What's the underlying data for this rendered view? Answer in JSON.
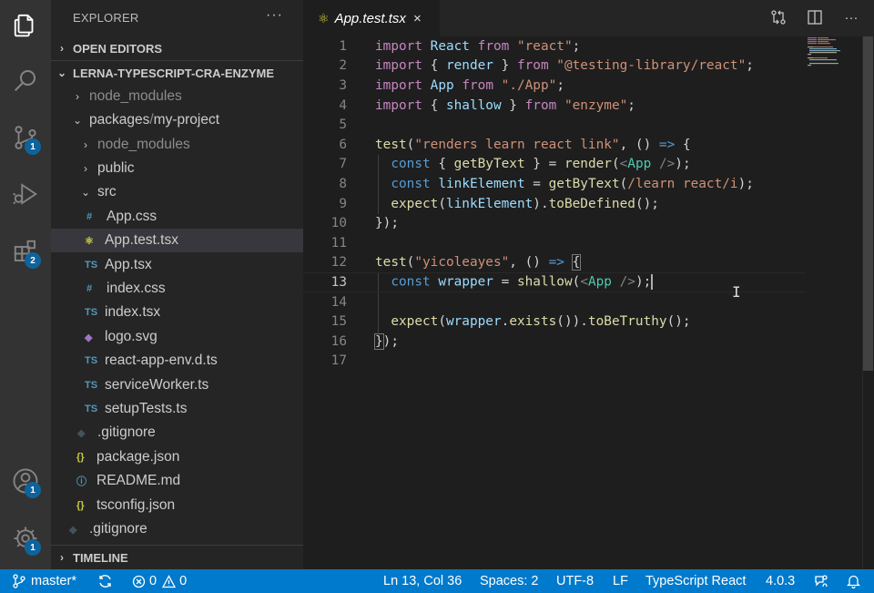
{
  "activity_bar": {
    "items": [
      {
        "name": "explorer",
        "icon": "files-icon",
        "badge": ""
      },
      {
        "name": "search",
        "icon": "search-icon",
        "badge": ""
      },
      {
        "name": "source-control",
        "icon": "source-control-icon",
        "badge": "1"
      },
      {
        "name": "run",
        "icon": "run-debug-icon",
        "badge": ""
      },
      {
        "name": "extensions",
        "icon": "extensions-icon",
        "badge": "2"
      }
    ],
    "accounts_badge": "1",
    "settings_badge": "1"
  },
  "sidebar": {
    "title": "EXPLORER",
    "more": "···",
    "open_editors": "OPEN EDITORS",
    "project": "LERNA-TYPESCRIPT-CRA-ENZYME",
    "timeline": "TIMELINE",
    "tree": [
      {
        "label": "node_modules",
        "icon": "",
        "chev": "›",
        "dim": true
      },
      {
        "label_a": "packages",
        "sep": " / ",
        "label_b": "my-project",
        "chev": "⌄"
      },
      {
        "label": "node_modules",
        "chev": "›",
        "dim": true
      },
      {
        "label": "public",
        "chev": "›"
      },
      {
        "label": "src",
        "chev": "⌄"
      },
      {
        "label": "App.css",
        "icon": "#"
      },
      {
        "label": "App.test.tsx",
        "icon": "⚛"
      },
      {
        "label": "App.tsx",
        "icon": "TS"
      },
      {
        "label": "index.css",
        "icon": "#"
      },
      {
        "label": "index.tsx",
        "icon": "TS"
      },
      {
        "label": "logo.svg",
        "icon": "◆"
      },
      {
        "label": "react-app-env.d.ts",
        "icon": "TS"
      },
      {
        "label": "serviceWorker.ts",
        "icon": "TS"
      },
      {
        "label": "setupTests.ts",
        "icon": "TS"
      },
      {
        "label": ".gitignore",
        "icon": "◆"
      },
      {
        "label": "package.json",
        "icon": "{}"
      },
      {
        "label": "README.md",
        "icon": "ⓘ"
      },
      {
        "label": "tsconfig.json",
        "icon": "{}"
      },
      {
        "label": ".gitignore",
        "icon": "◆"
      }
    ]
  },
  "editor": {
    "tab_label": "App.test.tsx",
    "tab_close": "×",
    "line_numbers": [
      "1",
      "2",
      "3",
      "4",
      "5",
      "6",
      "7",
      "8",
      "9",
      "10",
      "11",
      "12",
      "13",
      "14",
      "15",
      "16",
      "17"
    ],
    "cursor_line": 13
  },
  "status_bar": {
    "branch": "master*",
    "errors": "0",
    "warnings": "0",
    "position": "Ln 13, Col 36",
    "spaces": "Spaces: 2",
    "encoding": "UTF-8",
    "eol": "LF",
    "language": "TypeScript React",
    "ts_version": "4.0.3"
  },
  "colors": {
    "accent": "#007acc",
    "badge": "#0e639c",
    "sidebar_bg": "#252526",
    "editor_bg": "#1e1e1e"
  }
}
